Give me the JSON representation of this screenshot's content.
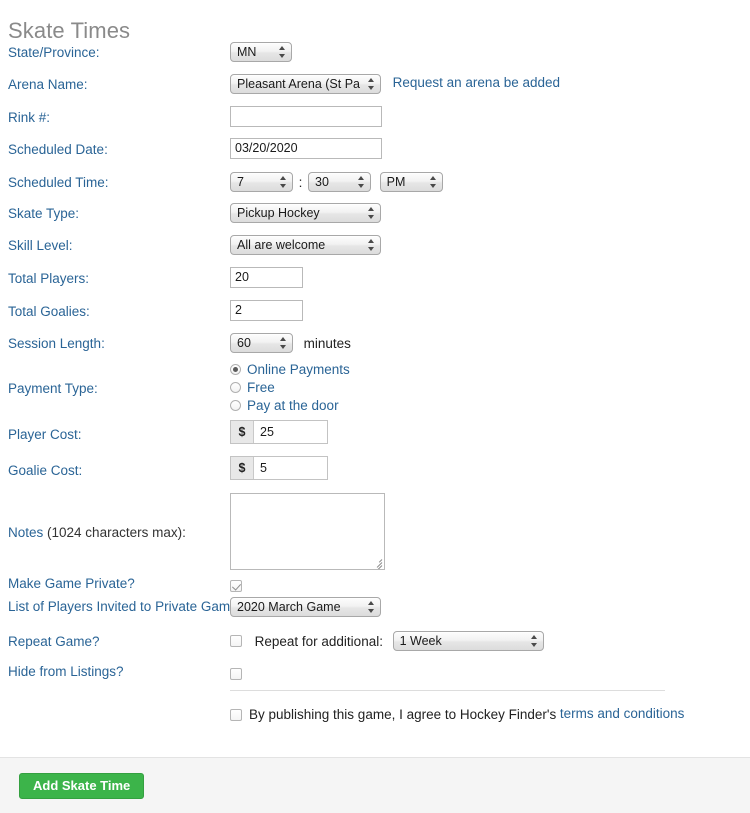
{
  "page": {
    "title": "Skate Times"
  },
  "fields": {
    "state": {
      "label": "State/Province:",
      "value": "MN"
    },
    "arena": {
      "label": "Arena Name:",
      "value": "Pleasant Arena (St Pau",
      "link_text": "Request an arena be added"
    },
    "rink": {
      "label": "Rink #:",
      "value": ""
    },
    "date": {
      "label": "Scheduled Date:",
      "value": "03/20/2020"
    },
    "time": {
      "label": "Scheduled Time:",
      "hour": "7",
      "separator": ":",
      "minute": "30",
      "meridiem": "PM"
    },
    "skate_type": {
      "label": "Skate Type:",
      "value": "Pickup Hockey"
    },
    "skill_level": {
      "label": "Skill Level:",
      "value": "All are welcome"
    },
    "total_players": {
      "label": "Total Players:",
      "value": "20"
    },
    "total_goalies": {
      "label": "Total Goalies:",
      "value": "2"
    },
    "session_length": {
      "label": "Session Length:",
      "value": "60",
      "suffix": "minutes"
    },
    "payment_type": {
      "label": "Payment Type:",
      "options": [
        {
          "label": "Online Payments",
          "selected": true
        },
        {
          "label": "Free",
          "selected": false
        },
        {
          "label": "Pay at the door",
          "selected": false
        }
      ]
    },
    "player_cost": {
      "label": "Player Cost:",
      "currency": "$",
      "value": "25"
    },
    "goalie_cost": {
      "label": "Goalie Cost:",
      "currency": "$",
      "value": "5"
    },
    "notes": {
      "label_link": "Notes",
      "label_plain": " (1024 characters max):",
      "value": ""
    },
    "make_private": {
      "label": "Make Game Private?",
      "checked": true
    },
    "invited_list": {
      "label": "List of Players Invited to Private Game",
      "value": "2020 March Game"
    },
    "repeat_game": {
      "label": "Repeat Game?",
      "checked": false,
      "inline_label": "Repeat for additional:",
      "interval": "1 Week"
    },
    "hide_listings": {
      "label": "Hide from Listings?",
      "checked": false
    },
    "terms": {
      "checked": false,
      "text": "By publishing this game, I agree to Hockey Finder's",
      "link_text": "terms and conditions"
    }
  },
  "footer": {
    "submit_label": "Add Skate Time"
  },
  "colors": {
    "label_blue": "#2a6496",
    "title_gray": "#8a8a8a",
    "primary_green": "#3cb44a",
    "footer_bg": "#f5f5f5"
  }
}
